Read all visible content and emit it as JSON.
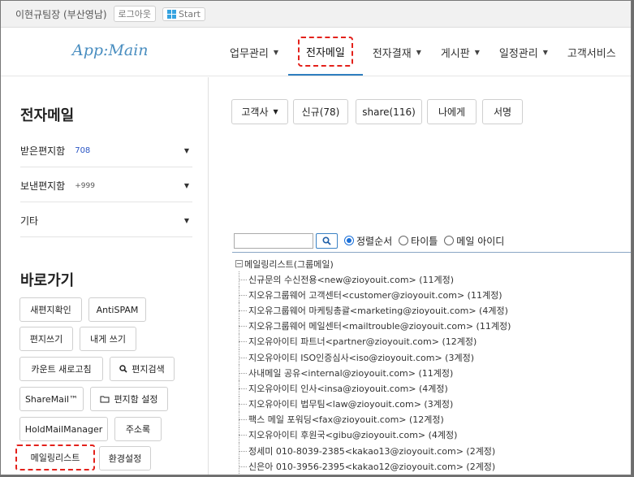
{
  "userbar": {
    "user": "이현규팀장 (부산영남)",
    "logout": "로그아웃",
    "start": "Start"
  },
  "logo": {
    "text": "App:Main"
  },
  "nav": [
    {
      "label": "업무관리",
      "icon": "caret-down-icon"
    },
    {
      "label": "전자메일",
      "icon": "caret-down-icon",
      "active": true
    },
    {
      "label": "전자결재",
      "icon": "caret-down-icon"
    },
    {
      "label": "게시판",
      "icon": "caret-down-icon"
    },
    {
      "label": "일정관리",
      "icon": "caret-down-icon"
    },
    {
      "label": "고객서비스",
      "icon": "caret-down-icon"
    }
  ],
  "sidebar": {
    "title": "전자메일",
    "folders": [
      {
        "label": "받은편지함",
        "count": "708"
      },
      {
        "label": "보낸편지함",
        "count": "+999"
      },
      {
        "label": "기타",
        "count": ""
      }
    ],
    "shortcuts_title": "바로가기",
    "shortcuts": [
      {
        "label": "새편지확인"
      },
      {
        "label": "AntiSPAM"
      },
      {
        "label": "편지쓰기"
      },
      {
        "label": "내게 쓰기"
      },
      {
        "label": "카운트 새로고침"
      },
      {
        "label": "편지검색",
        "icon": "search-icon"
      },
      {
        "label": "ShareMail™"
      },
      {
        "label": "편지함 설정",
        "icon": "folder-icon"
      },
      {
        "label": "HoldMailManager"
      },
      {
        "label": "주소록"
      },
      {
        "label": "메일링리스트"
      },
      {
        "label": "환경설정"
      }
    ]
  },
  "main": {
    "toolbar": [
      {
        "label": "고객사",
        "icon": "caret-down-icon"
      },
      {
        "label": "신규(78)"
      },
      {
        "label": "share(116)"
      },
      {
        "label": "나에게"
      },
      {
        "label": "서명"
      }
    ],
    "search": {
      "value": "",
      "options": [
        {
          "label": "정렬순서",
          "selected": true
        },
        {
          "label": "타이틀",
          "selected": false
        },
        {
          "label": "메일 아이디",
          "selected": false
        }
      ]
    },
    "tree": {
      "root": "메일링리스트(그룹메일)",
      "items": [
        "신규문의 수신전용<new@zioyouit.com> (11계정)",
        "지오유그룹웨어 고객센터<customer@zioyouit.com> (11계정)",
        "지오유그룹웨어 마케팅총괄<marketing@zioyouit.com> (4계정)",
        "지오유그룹웨어 메일센터<mailtrouble@zioyouit.com> (11계정)",
        "지오유아이티 파트너<partner@zioyouit.com> (12계정)",
        "지오유아이티 ISO인증심사<iso@zioyouit.com> (3계정)",
        "사내메일 공유<internal@zioyouit.com> (11계정)",
        "지오유아이티 인사<insa@zioyouit.com> (4계정)",
        "지오유아이티 법무팀<law@zioyouit.com> (3계정)",
        "팩스 메일 포워딩<fax@zioyouit.com> (12계정)",
        "지오유아이티 후원국<gibu@zioyouit.com> (4계정)",
        "정세미 010-8039-2385<kakao13@zioyouit.com> (2계정)",
        "신은아 010-3956-2395<kakao12@zioyouit.com> (2계정)"
      ]
    }
  }
}
